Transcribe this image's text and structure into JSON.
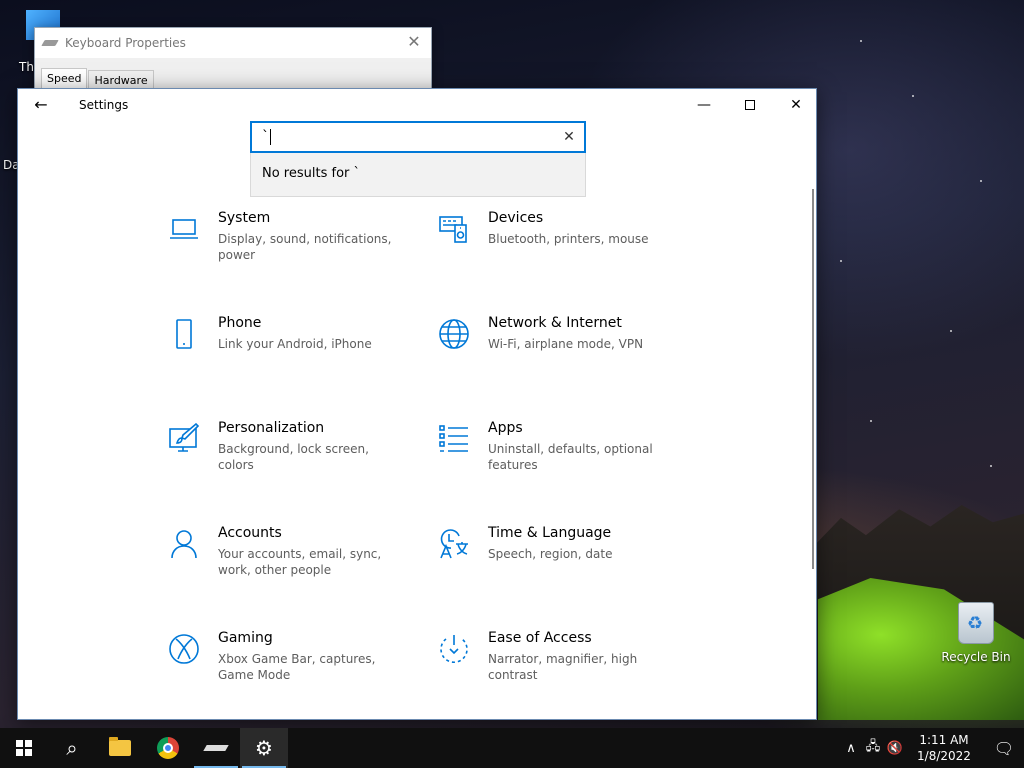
{
  "desktop": {
    "recycle_bin_label": "Recycle Bin",
    "this_pc_label": "Thi",
    "partial_label": "Da"
  },
  "keyboard_window": {
    "title": "Keyboard Properties",
    "close_glyph": "✕",
    "tabs": [
      "Speed",
      "Hardware"
    ]
  },
  "settings": {
    "title": "Settings",
    "back_glyph": "←",
    "min_glyph": "—",
    "close_glyph": "✕",
    "search": {
      "value": "`",
      "clear_glyph": "✕",
      "no_results": "No results for `"
    },
    "categories": [
      {
        "name": "System",
        "desc": "Display, sound, notifications, power",
        "icon": "laptop-icon"
      },
      {
        "name": "Devices",
        "desc": "Bluetooth, printers, mouse",
        "icon": "devices-icon"
      },
      {
        "name": "Phone",
        "desc": "Link your Android, iPhone",
        "icon": "phone-icon"
      },
      {
        "name": "Network & Internet",
        "desc": "Wi-Fi, airplane mode, VPN",
        "icon": "globe-icon"
      },
      {
        "name": "Personalization",
        "desc": "Background, lock screen, colors",
        "icon": "brush-icon"
      },
      {
        "name": "Apps",
        "desc": "Uninstall, defaults, optional features",
        "icon": "apps-list-icon"
      },
      {
        "name": "Accounts",
        "desc": "Your accounts, email, sync, work, other people",
        "icon": "person-icon"
      },
      {
        "name": "Time & Language",
        "desc": "Speech, region, date",
        "icon": "time-language-icon"
      },
      {
        "name": "Gaming",
        "desc": "Xbox Game Bar, captures, Game Mode",
        "icon": "xbox-icon"
      },
      {
        "name": "Ease of Access",
        "desc": "Narrator, magnifier, high contrast",
        "icon": "ease-of-access-icon"
      }
    ],
    "accent_color": "#0078d7"
  },
  "taskbar": {
    "search_glyph": "⌕",
    "tray_chevron": "∧",
    "network_glyph": "🖧",
    "volume_glyph": "🔇",
    "notif_glyph": "🗨",
    "time": "1:11 AM",
    "date": "1/8/2022"
  }
}
